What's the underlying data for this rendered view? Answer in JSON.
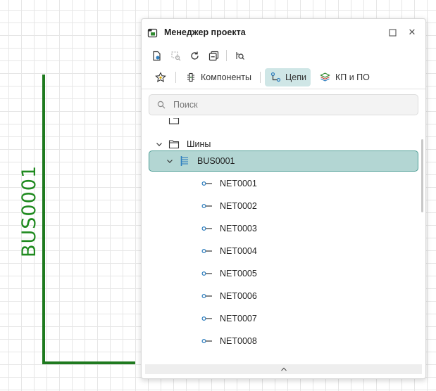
{
  "canvas": {
    "bus_label": "BUS0001",
    "bus_color": "#1f7a1f"
  },
  "panel": {
    "title": "Менеджер проекта",
    "title_icon": "project-manager-icon",
    "window_buttons": {
      "maximize_icon": "maximize-icon",
      "close_icon": "close-icon",
      "close_glyph": "✕"
    },
    "toolbar": [
      "locate-icon",
      "zoom-selection-icon",
      "refresh-icon",
      "collapse-all-icon",
      "find-in-tree-icon"
    ],
    "tabs": [
      {
        "label": "",
        "icon": "star-icon",
        "active": false
      },
      {
        "label": "Компоненты",
        "icon": "component-icon",
        "active": false
      },
      {
        "label": "Цепи",
        "icon": "net-icon",
        "active": true
      },
      {
        "label": "КП и ПО",
        "icon": "layers-icon",
        "active": false
      }
    ],
    "search": {
      "placeholder": "Поиск",
      "value": ""
    },
    "tree": {
      "folder": {
        "label": "Шины",
        "expanded": true
      },
      "bus": {
        "label": "BUS0001",
        "expanded": true,
        "selected": true
      },
      "nets": [
        "NET0001",
        "NET0002",
        "NET0003",
        "NET0004",
        "NET0005",
        "NET0006",
        "NET0007",
        "NET0008"
      ]
    },
    "scroll_up_glyph": "^",
    "accent": "#b3d6d3"
  }
}
